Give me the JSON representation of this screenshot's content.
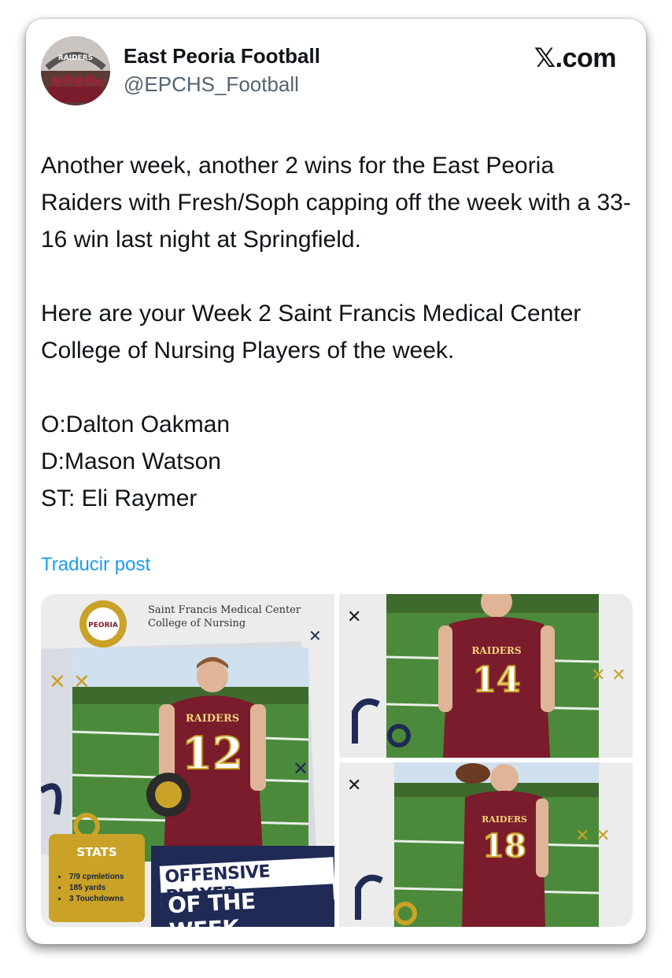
{
  "brand": {
    "label": "𝕏.com"
  },
  "author": {
    "name": "East Peoria Football",
    "handle": "@EPCHS_Football",
    "avatar_text": "RAIDERS"
  },
  "post": {
    "paragraph_1": "Another week, another 2 wins for the East Peoria Raiders with Fresh/Soph capping off the week with a 33-16 win last night at Springfield.",
    "paragraph_2": "Here are your Week 2 Saint Francis Medical Center College of Nursing Players of the week.",
    "paragraph_3": "O:Dalton Oakman\nD:Mason Watson\nST: Eli Raymer",
    "translate_label": "Traducir post"
  },
  "media": {
    "main": {
      "sponsor_line_1": "Saint Francis Medical Center",
      "sponsor_line_2": "College of Nursing",
      "seal_text": "PEORIA",
      "jersey_team": "RAIDERS",
      "jersey_number": "12",
      "stats_title": "STATS",
      "stats": [
        "7/9 cpmletions",
        "185 yards",
        "3 Touchdowns"
      ],
      "banner_line_1": "OFFENSIVE PLAYER",
      "banner_line_2": "OF THE WEEK"
    },
    "top_right": {
      "jersey_team": "RAIDERS",
      "jersey_number": "14"
    },
    "bottom_right": {
      "jersey_team": "RAIDERS",
      "jersey_number": "18"
    }
  },
  "colors": {
    "maroon": "#7a1c2c",
    "gold": "#c9a227",
    "navy": "#1f2a55",
    "link": "#1d9bf0",
    "handle": "#536471"
  }
}
